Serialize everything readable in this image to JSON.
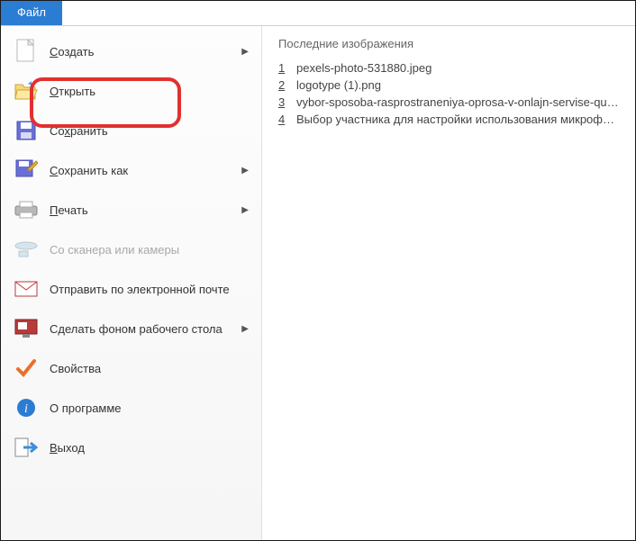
{
  "tab": {
    "label": "Файл"
  },
  "menu": {
    "create": {
      "label": "Создать",
      "underline_index": 0
    },
    "open": {
      "label": "Открыть",
      "underline_index": 0
    },
    "save": {
      "label": "Сохранить",
      "underline_index": 2
    },
    "saveas": {
      "label": "Сохранить как",
      "underline_index": 0
    },
    "print": {
      "label": "Печать",
      "underline_index": 0
    },
    "scanner": {
      "label": "Со сканера или камеры"
    },
    "email": {
      "label": "Отправить по электронной почте"
    },
    "wallpaper": {
      "label": "Сделать фоном рабочего стола"
    },
    "props": {
      "label": "Свойства"
    },
    "about": {
      "label": "О программе"
    },
    "exit": {
      "label": "Выход",
      "underline_index": 0
    }
  },
  "recent": {
    "title": "Последние изображения",
    "items": [
      {
        "n": "1",
        "name": "pexels-photo-531880.jpeg"
      },
      {
        "n": "2",
        "name": "logotype (1).png"
      },
      {
        "n": "3",
        "name": "vybor-sposoba-rasprostraneniya-oprosa-v-onlajn-servise-questionsta..."
      },
      {
        "n": "4",
        "name": "Выбор участника для настройки использования микрофона в мо..."
      }
    ]
  }
}
